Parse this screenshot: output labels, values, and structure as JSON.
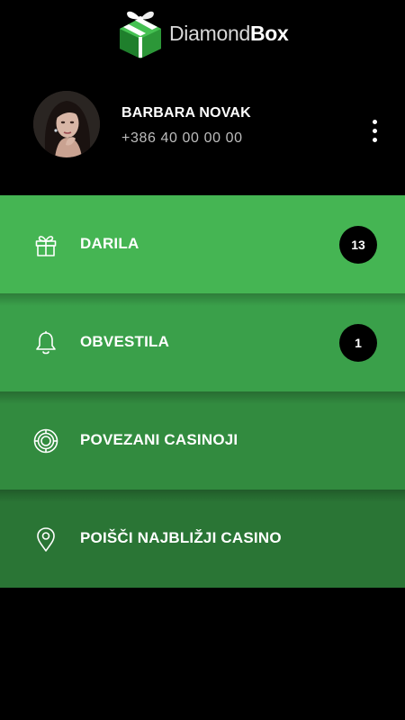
{
  "header": {
    "logo_text_light": "Diamond",
    "logo_text_bold": "Box",
    "logo_icon": "gift-box-icon",
    "colors": {
      "logo_green": "#2fa13c",
      "logo_white": "#ffffff"
    }
  },
  "profile": {
    "name": "BARBARA NOVAK",
    "phone": "+386 40 00 00 00",
    "more_icon": "more-vertical-icon"
  },
  "menu": {
    "items": [
      {
        "label": "DARILA",
        "icon": "gift-icon",
        "badge": "13",
        "color": "#45b553"
      },
      {
        "label": "OBVESTILA",
        "icon": "bell-icon",
        "badge": "1",
        "color": "#3aa04a"
      },
      {
        "label": "POVEZANI CASINOJI",
        "icon": "casino-chip-icon",
        "color": "#328b3f"
      },
      {
        "label": "POIŠČI NAJBLIŽJI CASINO",
        "icon": "location-pin-icon",
        "color": "#2a7535"
      }
    ]
  },
  "colors": {
    "background": "#000000",
    "badge_bg": "#000000",
    "text": "#ffffff"
  }
}
